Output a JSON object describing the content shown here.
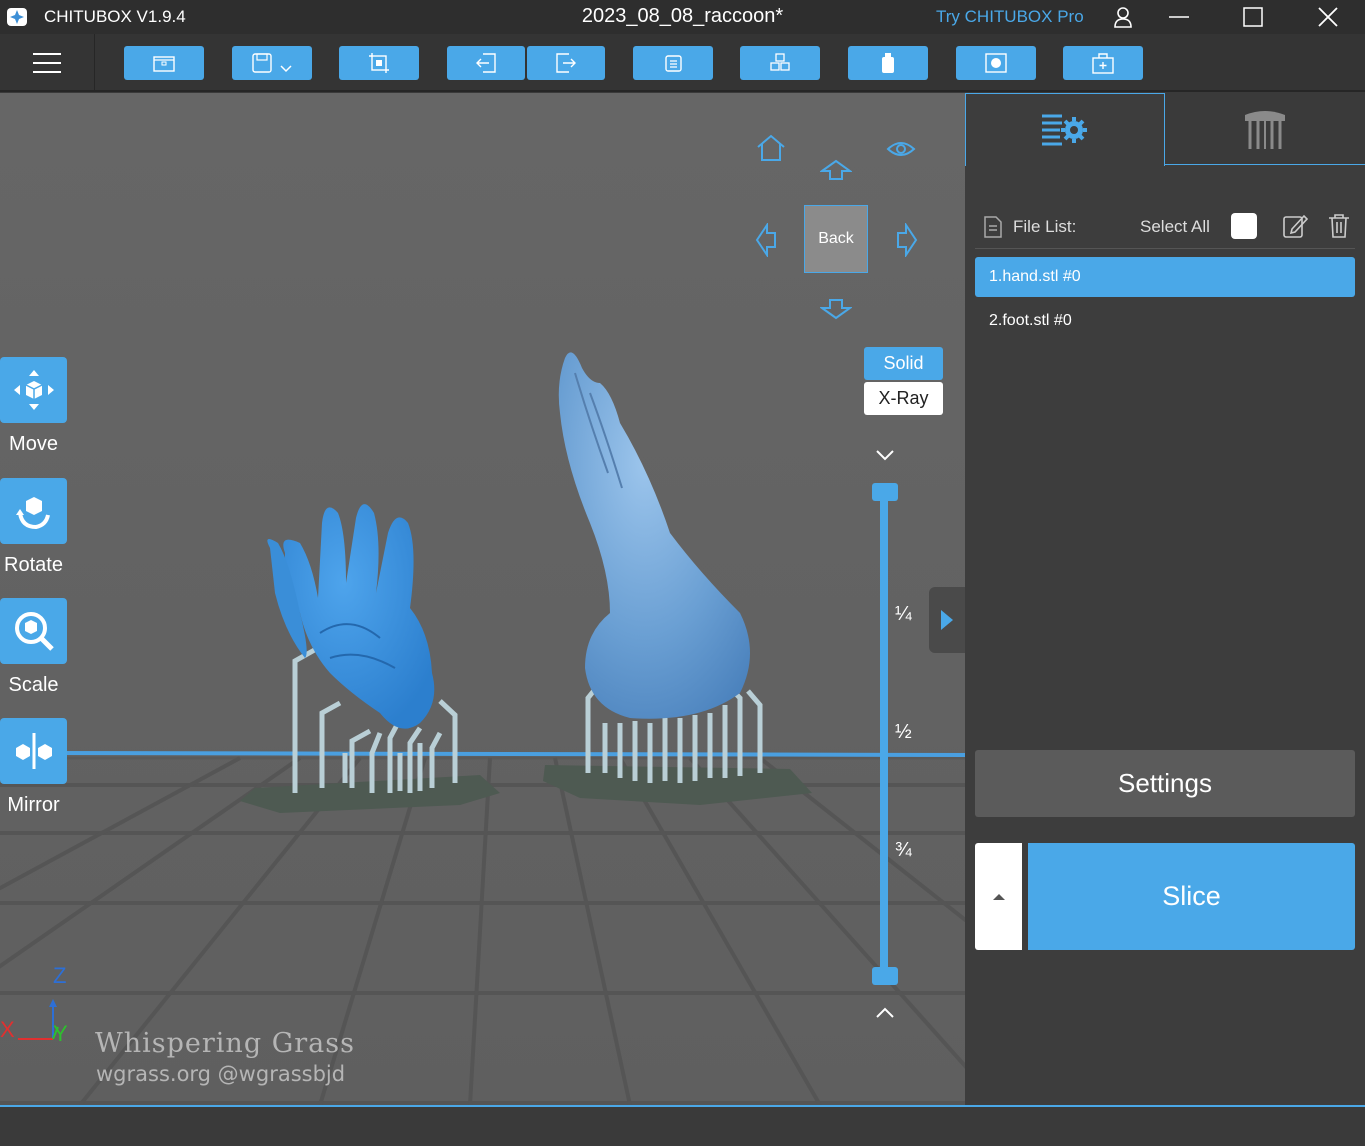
{
  "titlebar": {
    "app_name": "CHITUBOX V1.9.4",
    "doc_title": "2023_08_08_raccoon*",
    "promo": "Try CHITUBOX Pro"
  },
  "toolbar": {
    "buttons": [
      "open-file",
      "save",
      "crop",
      "import",
      "export",
      "copy",
      "arrange",
      "support",
      "hollow",
      "duplicate"
    ]
  },
  "view_cube": {
    "face_label": "Back"
  },
  "render_mode": {
    "solid_label": "Solid",
    "xray_label": "X-Ray"
  },
  "slider": {
    "marks": [
      "¼",
      "½",
      "¾"
    ]
  },
  "tools": {
    "move": "Move",
    "rotate": "Rotate",
    "scale": "Scale",
    "mirror": "Mirror"
  },
  "axes": {
    "x": "X",
    "y": "Y",
    "z": "Z"
  },
  "watermark": {
    "line1": "Whispering Grass",
    "line2": "wgrass.org @wgrassbjd"
  },
  "file_panel": {
    "title": "File List:",
    "select_all": "Select All",
    "files": [
      "1.hand.stl #0",
      "2.foot.stl #0"
    ],
    "selected_index": 0
  },
  "actions": {
    "settings": "Settings",
    "slice": "Slice"
  },
  "colors": {
    "accent": "#4aa8e8",
    "model": "#3d8fd6",
    "background": "#656565"
  }
}
